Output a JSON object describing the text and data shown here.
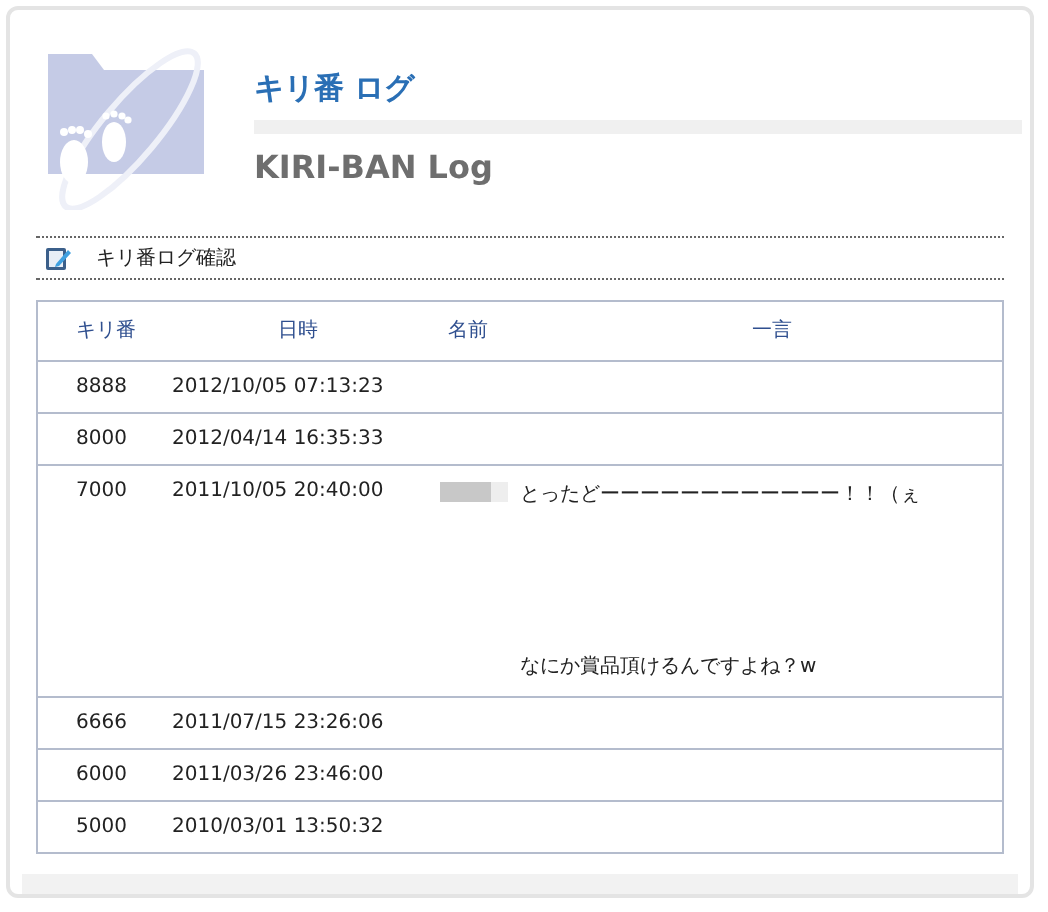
{
  "header": {
    "title": "キリ番 ログ",
    "subtitle": "KIRI-BAN Log"
  },
  "nav": {
    "label": "キリ番ログ確認"
  },
  "table": {
    "columns": [
      "キリ番",
      "日時",
      "名前",
      "一言"
    ],
    "rows": [
      {
        "number": "8888",
        "datetime": "2012/10/05 07:13:23",
        "name_redacted": false,
        "comment": []
      },
      {
        "number": "8000",
        "datetime": "2012/04/14 16:35:33",
        "name_redacted": false,
        "comment": []
      },
      {
        "number": "7000",
        "datetime": "2011/10/05 20:40:00",
        "name_redacted": true,
        "comment": [
          "とったどーーーーーーーーーーーー！！（ぇ",
          "なにか賞品頂けるんですよね？w"
        ]
      },
      {
        "number": "6666",
        "datetime": "2011/07/15 23:26:06",
        "name_redacted": false,
        "comment": []
      },
      {
        "number": "6000",
        "datetime": "2011/03/26 23:46:00",
        "name_redacted": false,
        "comment": []
      },
      {
        "number": "5000",
        "datetime": "2010/03/01 13:50:32",
        "name_redacted": false,
        "comment": []
      }
    ]
  }
}
